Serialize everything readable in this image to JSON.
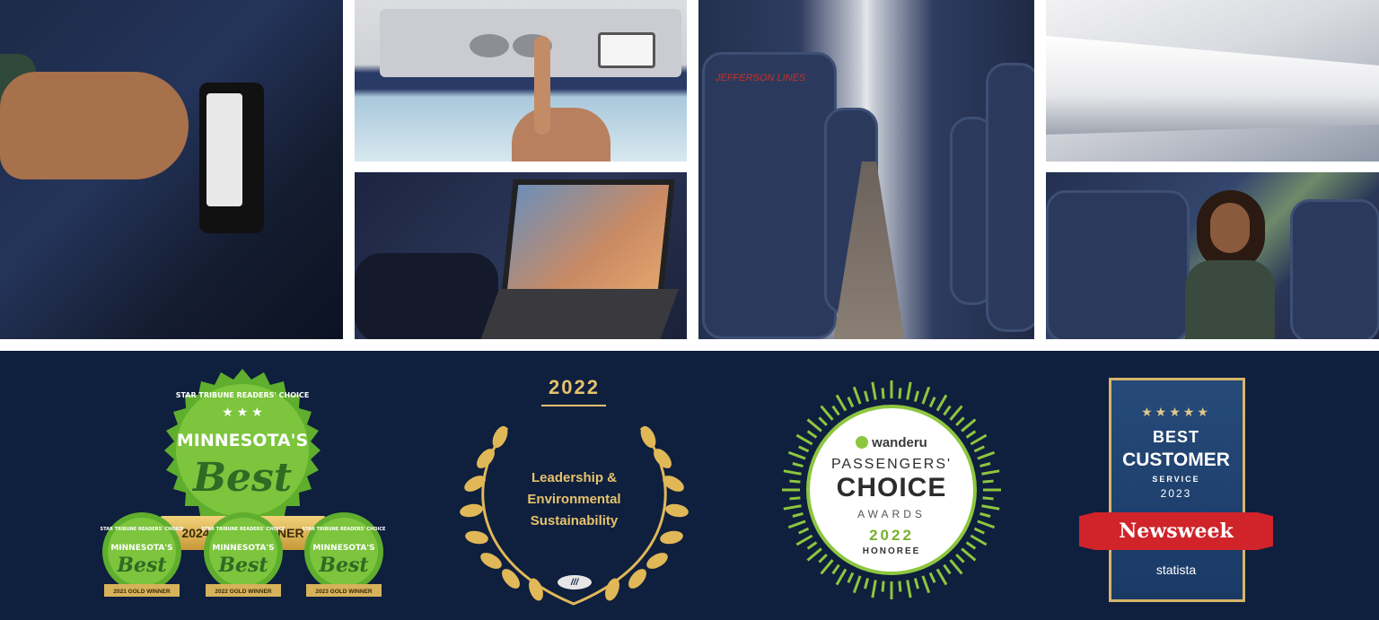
{
  "photos": {
    "seat_headrest_brand": "JEFFERSON LINES"
  },
  "awards": {
    "minnesota": {
      "arc_text": "STAR TRIBUNE READERS' CHOICE",
      "title": "MINNESOTA'S",
      "best": "Best",
      "ribbon": "2024 GOLD WINNER",
      "small_title": "MINNESOTA'S",
      "small_best": "Best",
      "small_arc": "STAR TRIBUNE READERS' CHOICE",
      "winners": [
        "2021 GOLD WINNER",
        "2022 GOLD WINNER",
        "2023 GOLD WINNER"
      ]
    },
    "leadership": {
      "year": "2022",
      "line1": "Leadership &",
      "line2": "Environmental",
      "line3": "Sustainability"
    },
    "wanderu": {
      "brand": "wanderu",
      "line1": "PASSENGERS'",
      "line2": "CHOICE",
      "line3": "AWARDS",
      "year": "2022",
      "honoree": "HONOREE"
    },
    "newsweek": {
      "stars": "★★★★★",
      "best": "BEST",
      "customer": "CUSTOMER",
      "service": "SERVICE",
      "year": "2023",
      "brand": "Newsweek",
      "partner": "statista"
    }
  },
  "colors": {
    "band": "#0f1f3e",
    "gold": "#e6c26b",
    "green": "#8dc63f",
    "newsweek_red": "#d0232a"
  }
}
